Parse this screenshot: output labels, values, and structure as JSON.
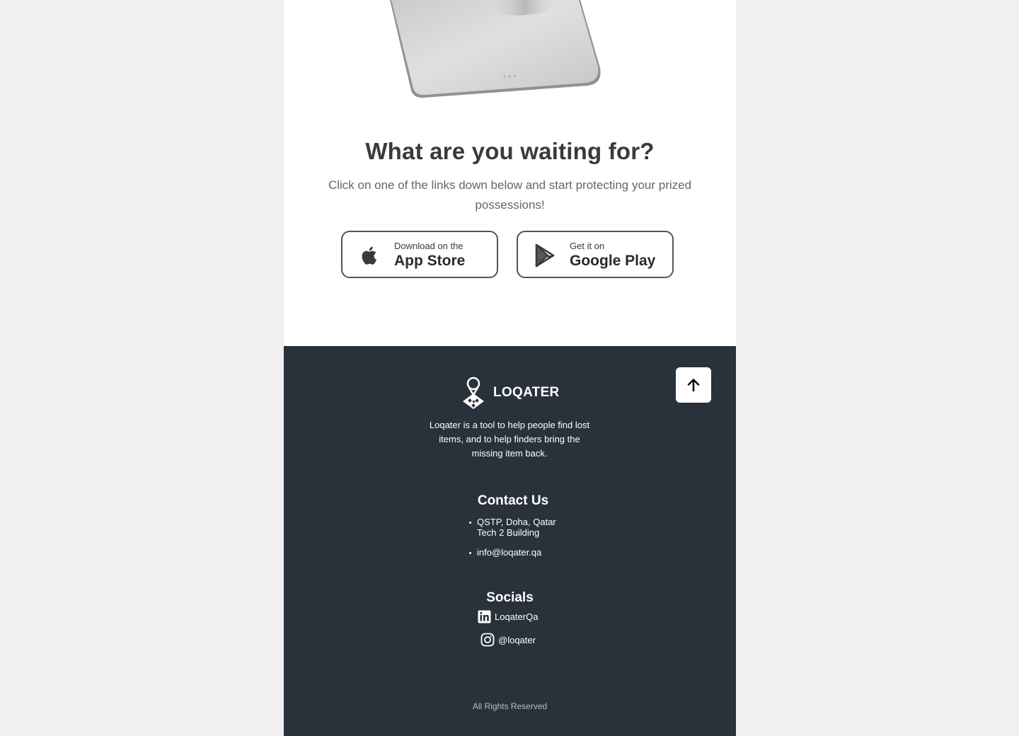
{
  "cta": {
    "title": "What are you waiting for?",
    "subtitle": "Click on one of the links down below and start protecting your prized possessions!"
  },
  "app_store": {
    "small": "Download on the",
    "big": "App Store",
    "icon": "apple-icon"
  },
  "google_play": {
    "small": "Get it on",
    "big": "Google Play",
    "icon": "play-store-icon"
  },
  "footer": {
    "brand": "LOQATER",
    "tagline": "Loqater is a tool to help people find lost items, and to help finders bring the missing item back.",
    "contact_title": "Contact Us",
    "address_line1": "QSTP, Doha, Qatar",
    "address_line2": "Tech 2 Building",
    "email": "info@loqater.qa",
    "socials_title": "Socials",
    "linkedin": "LoqaterQa",
    "instagram": "@loqater",
    "rights": "All Rights Reserved",
    "back_to_top_icon": "arrow-up-icon"
  },
  "colors": {
    "footer_bg": "#29313b",
    "page_bg": "#f0f0f0",
    "title": "#3a3a3a",
    "subtitle": "#666666"
  }
}
